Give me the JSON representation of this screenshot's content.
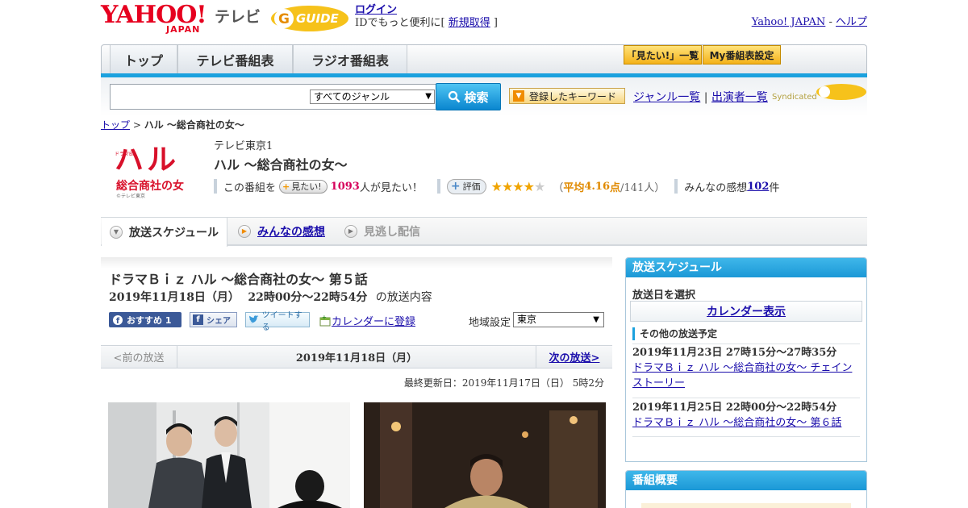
{
  "header": {
    "yahoo_logo": "YAHOO!",
    "yahoo_sub": "JAPAN",
    "tv_label": "テレビ",
    "gguide_logo": "GUIDE",
    "login": "ログイン",
    "login_desc_pre": "IDでもっと便利に[ ",
    "signup": "新規取得",
    "login_desc_post": " ]",
    "yahoo_japan": "Yahoo! JAPAN",
    "help_sep": " - ",
    "help": "ヘルプ"
  },
  "nav": {
    "tabs": [
      "トップ",
      "テレビ番組表",
      "ラジオ番組表"
    ],
    "want_list": "「見たい!」一覧",
    "my_schedule": "My番組表設定"
  },
  "search": {
    "placeholder": "",
    "genre_selected": "すべてのジャンル",
    "button": "検索",
    "keyword_button": "登録したキーワード",
    "genre_list": "ジャンル一覧",
    "link_sep": " | ",
    "performer_list": "出演者一覧",
    "syndicated": "Syndicated"
  },
  "breadcrumb": {
    "top": "トップ",
    "sep": " > ",
    "current": "ハル ～総合商社の女～"
  },
  "program": {
    "logo_text": "ハル",
    "logo_sub": "総合商社の女",
    "logo_small": "ドラマBiz",
    "logo_credit": "©テレビ東京",
    "channel": "テレビ東京1",
    "title": "ハル ～総合商社の女～",
    "want_pre": "この番組を",
    "want_button": "見たい!",
    "want_count": "1093",
    "want_post": "人が見たい！",
    "rate_button": "評価",
    "rating_stars": 4,
    "rating_open": "（",
    "rating_label": "平均",
    "rating_avg": "4.16",
    "rating_unit": "点",
    "rating_count": "/141人）",
    "reviews_pre": "みんなの感想 ",
    "reviews_count": "102",
    "reviews_post": "件"
  },
  "program_tabs": [
    "放送スケジュール",
    "みんなの感想",
    "見逃し配信"
  ],
  "episode": {
    "title": "ドラマＢｉｚ ハル ～総合商社の女～ 第５話",
    "date": "2019年11月18日（月）",
    "time": "22時00分～22時54分",
    "date_suffix": "の放送内容",
    "fb_recommend": "おすすめ 1",
    "fb_share": "シェア",
    "tweet": "ツイートする",
    "calendar": "カレンダーに登録",
    "region_label": "地域設定",
    "region_selected": "東京"
  },
  "date_nav": {
    "prev": "<前の放送",
    "current": "2019年11月18日（月）",
    "next": "次の放送>"
  },
  "last_updated": "最終更新日：2019年11月17日（日） 5時2分",
  "sidebar": {
    "schedule_title": "放送スケジュール",
    "select_date": "放送日を選択",
    "calendar_button": "カレンダー表示",
    "other_title": "その他の放送予定",
    "items": [
      {
        "time": "2019年11月23日 27時15分～27時35分",
        "title": "ドラマＢｉｚ ハル ～総合商社の女～ チェインストーリー"
      },
      {
        "time": "2019年11月25日 22時00分～22時54分",
        "title": "ドラマＢｉｚ ハル ～総合商社の女～ 第６話"
      }
    ],
    "summary_title": "番組概要"
  },
  "colors": {
    "accent_blue": "#1ba1de",
    "yahoo_red": "#e6001f",
    "want_pink": "#d6005b",
    "rating_orange": "#e08a00"
  }
}
